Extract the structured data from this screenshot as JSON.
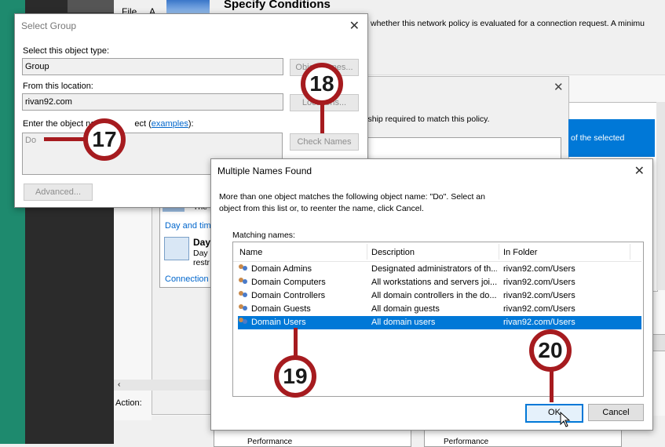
{
  "bg": {
    "menu_file": "File",
    "menu_a": "A",
    "heading": "Specify Conditions",
    "heading_desc": "whether this network policy is evaluated for a connection request. A minimu",
    "mid_text": "rship required to match this policy.",
    "selected_text": "of the selected",
    "link_day_time": "Day and tim",
    "day_title": "Day",
    "day_desc1": "Day",
    "day_desc2": "restr",
    "the_text": "The",
    "link_connection": "Connection",
    "action_label": "Action:",
    "bottom_a": "Performance",
    "bottom_b": "Performance"
  },
  "select_group": {
    "title": "Select Group",
    "object_type_label": "Select this object type:",
    "object_type_value": "Group",
    "object_types_button": "Object Types...",
    "location_label": "From this location:",
    "location_value": "rivan92.com",
    "locations_button": "Locations...",
    "enter_label_a": "Enter the object na",
    "enter_label_b": "ect (",
    "examples_link": "examples",
    "enter_label_c": "):",
    "name_value": "Do",
    "check_names_button": "Check Names",
    "advanced_button": "Advanced..."
  },
  "multiple_names": {
    "title": "Multiple Names Found",
    "message": "More than one object matches the following object name: \"Do\". Select an object from this list or, to reenter the name, click Cancel.",
    "matching_label": "Matching names:",
    "columns": [
      "Name",
      "Description",
      "In Folder"
    ],
    "rows": [
      {
        "name": "Domain Admins",
        "description": "Designated administrators of th...",
        "folder": "rivan92.com/Users"
      },
      {
        "name": "Domain Computers",
        "description": "All workstations and servers joi...",
        "folder": "rivan92.com/Users"
      },
      {
        "name": "Domain Controllers",
        "description": "All domain controllers in the do...",
        "folder": "rivan92.com/Users"
      },
      {
        "name": "Domain Guests",
        "description": "All domain guests",
        "folder": "rivan92.com/Users"
      },
      {
        "name": "Domain Users",
        "description": "All domain users",
        "folder": "rivan92.com/Users"
      }
    ],
    "ok_button": "OK",
    "cancel_button": "Cancel"
  },
  "callouts": {
    "c17": "17",
    "c18": "18",
    "c19": "19",
    "c20": "20"
  },
  "colors": {
    "accent": "#a61b1f",
    "selection": "#0078d7",
    "teal": "#1e8a6e"
  }
}
